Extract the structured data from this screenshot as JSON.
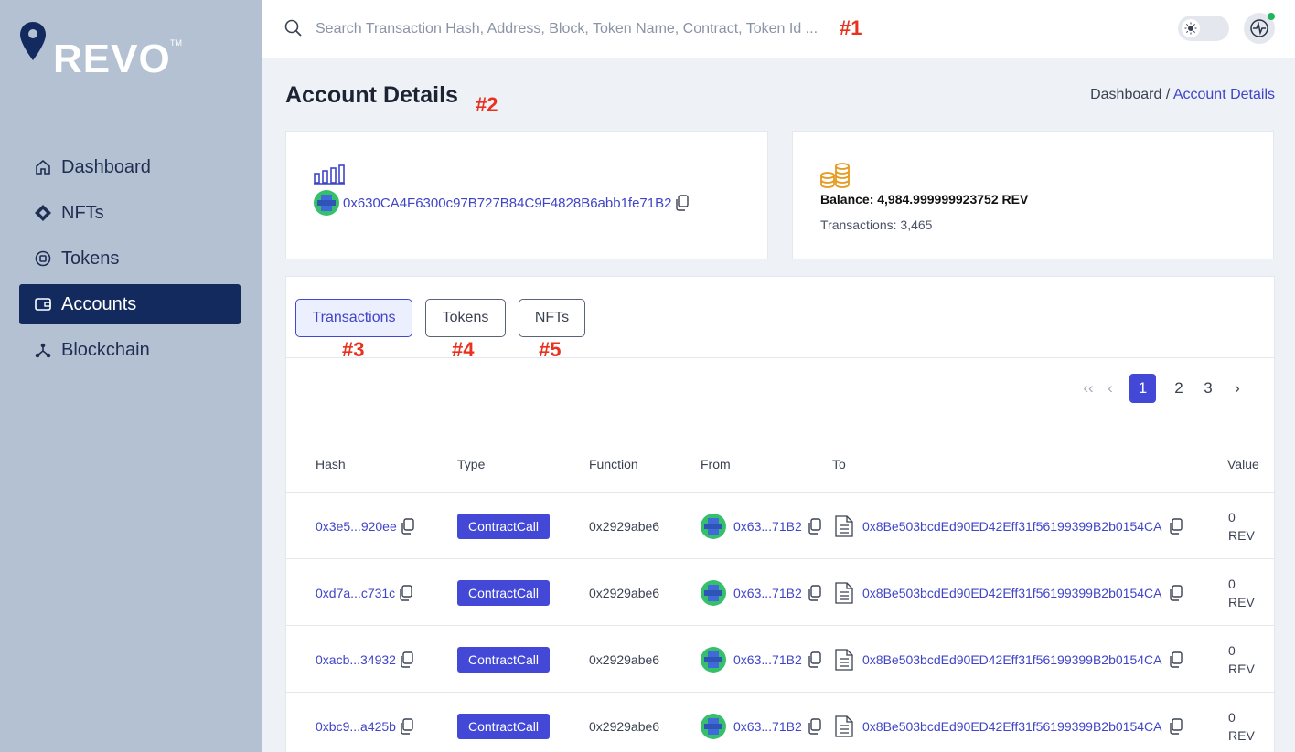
{
  "brand": {
    "name": "REVO",
    "tm": "TM"
  },
  "sidebar": {
    "items": [
      {
        "label": "Dashboard",
        "icon": "home-icon"
      },
      {
        "label": "NFTs",
        "icon": "diamond-icon"
      },
      {
        "label": "Tokens",
        "icon": "token-icon"
      },
      {
        "label": "Accounts",
        "icon": "wallet-icon",
        "active": true
      },
      {
        "label": "Blockchain",
        "icon": "network-icon"
      }
    ]
  },
  "topbar": {
    "search_placeholder": "Search Transaction Hash, Address, Block, Token Name, Contract, Token Id ...",
    "annotation": "#1"
  },
  "header": {
    "title": "Account Details",
    "annotation": "#2",
    "breadcrumb": {
      "parent": "Dashboard /",
      "current": "Account Details"
    }
  },
  "account": {
    "address": "0x630CA4F6300c97B727B84C9F4828B6abb1fe71B2",
    "balance": "Balance: 4,984.999999923752 REV",
    "transactions": "Transactions: 3,465"
  },
  "tabs": [
    {
      "label": "Transactions",
      "annotation": "#3",
      "active": true
    },
    {
      "label": "Tokens",
      "annotation": "#4"
    },
    {
      "label": "NFTs",
      "annotation": "#5"
    }
  ],
  "pager": {
    "first": "‹‹",
    "prev": "‹",
    "pages": [
      "1",
      "2",
      "3"
    ],
    "next": "›",
    "current": "1"
  },
  "table": {
    "columns": [
      "Hash",
      "Type",
      "Function",
      "From",
      "To",
      "Value"
    ],
    "rows": [
      {
        "hash": "0x3e5...920ee",
        "type": "ContractCall",
        "function": "0x2929abe6",
        "from": "0x63...71B2",
        "to": "0x8Be503bcdEd90ED42Eff31f56199399B2b0154CA",
        "value_num": "0",
        "value_unit": "REV"
      },
      {
        "hash": "0xd7a...c731c",
        "type": "ContractCall",
        "function": "0x2929abe6",
        "from": "0x63...71B2",
        "to": "0x8Be503bcdEd90ED42Eff31f56199399B2b0154CA",
        "value_num": "0",
        "value_unit": "REV"
      },
      {
        "hash": "0xacb...34932",
        "type": "ContractCall",
        "function": "0x2929abe6",
        "from": "0x63...71B2",
        "to": "0x8Be503bcdEd90ED42Eff31f56199399B2b0154CA",
        "value_num": "0",
        "value_unit": "REV"
      },
      {
        "hash": "0xbc9...a425b",
        "type": "ContractCall",
        "function": "0x2929abe6",
        "from": "0x63...71B2",
        "to": "0x8Be503bcdEd90ED42Eff31f56199399B2b0154CA",
        "value_num": "0",
        "value_unit": "REV"
      }
    ]
  },
  "colors": {
    "accent": "#4349d6",
    "sidebar_bg": "#b4c1d2",
    "sidebar_active": "#132a5e",
    "annotation": "#e8321f"
  }
}
